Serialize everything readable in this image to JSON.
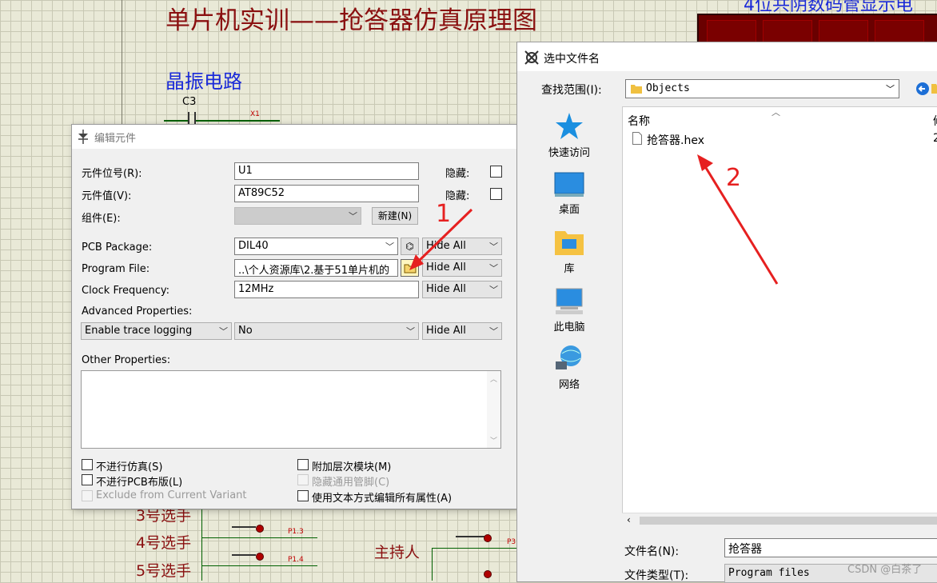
{
  "schematic": {
    "title": "单片机实训——抢答器仿真原理图",
    "crystal_section": "晶振电路",
    "display_section": "4位共阴数码管显示电",
    "cap_label": "C3",
    "crystal_label": "X1",
    "players": [
      "3号选手",
      "4号选手",
      "5号选手"
    ],
    "host": "主持人",
    "pin_labels": [
      "P1.3",
      "P1.4",
      "P3"
    ]
  },
  "edit_dialog": {
    "title": "编辑元件",
    "ref_label": "元件位号(R):",
    "ref_value": "U1",
    "value_label": "元件值(V):",
    "value_value": "AT89C52",
    "group_label": "组件(E):",
    "new_button": "新建(N)",
    "hidden_label": "隐藏:",
    "pcb_label": "PCB Package:",
    "pcb_value": "DIL40",
    "program_label": "Program File:",
    "program_value": "..\\个人资源库\\2.基于51单片机的",
    "clock_label": "Clock Frequency:",
    "clock_value": "12MHz",
    "hide_all": "Hide All",
    "advanced_label": "Advanced Properties:",
    "advanced_prop": "Enable trace logging",
    "advanced_value": "No",
    "other_label": "Other Properties:",
    "checkboxes_left": [
      "不进行仿真(S)",
      "不进行PCB布版(L)",
      "Exclude from Current Variant"
    ],
    "checkboxes_right": [
      "附加层次模块(M)",
      "隐藏通用管脚(C)",
      "使用文本方式编辑所有属性(A)"
    ]
  },
  "file_dialog": {
    "title": "选中文件名",
    "look_in_label": "查找范围(I):",
    "look_in_value": "Objects",
    "nav_items": [
      {
        "label": "快速访问",
        "icon": "star-icon"
      },
      {
        "label": "桌面",
        "icon": "desktop-icon"
      },
      {
        "label": "库",
        "icon": "library-icon"
      },
      {
        "label": "此电脑",
        "icon": "computer-icon"
      },
      {
        "label": "网络",
        "icon": "network-icon"
      }
    ],
    "column_name": "名称",
    "column_partial": "修",
    "partial_row_value": "2",
    "files": [
      "抢答器.hex"
    ],
    "filename_label": "文件名(N):",
    "filename_value": "抢答器",
    "filetype_label": "文件类型(T):",
    "filetype_value": "Program files"
  },
  "annotations": {
    "marker1": "1",
    "marker2": "2"
  },
  "watermark": "CSDN @白茶了"
}
